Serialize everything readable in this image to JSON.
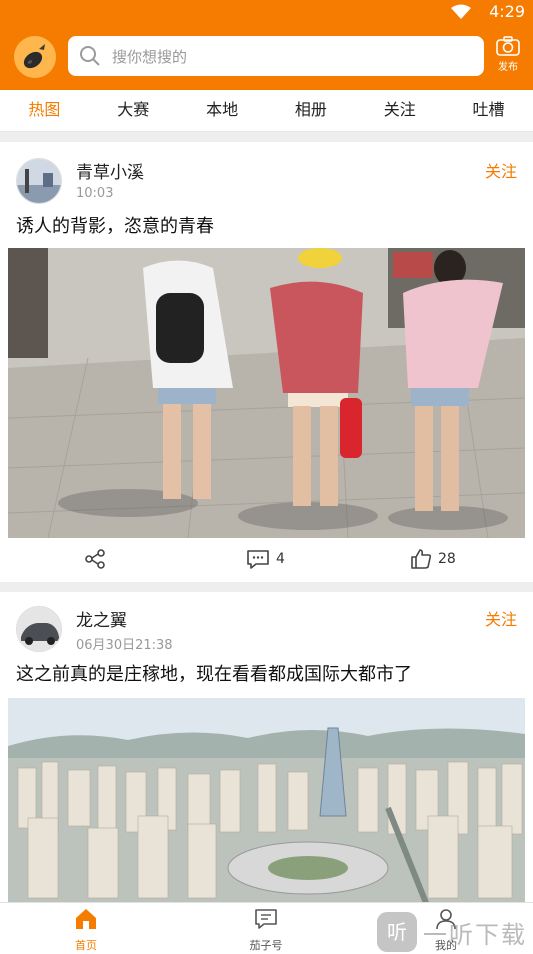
{
  "status": {
    "time": "4:29"
  },
  "header": {
    "search_placeholder": "搜你想搜的",
    "publish_label": "发布"
  },
  "tabs": [
    {
      "label": "热图",
      "active": true
    },
    {
      "label": "大赛"
    },
    {
      "label": "本地"
    },
    {
      "label": "相册"
    },
    {
      "label": "关注"
    },
    {
      "label": "吐槽"
    }
  ],
  "posts": [
    {
      "author": "青草小溪",
      "time": "10:03",
      "follow_label": "关注",
      "text": "诱人的背影，恣意的青春",
      "comments": "4",
      "likes": "28"
    },
    {
      "author": "龙之翼",
      "time": "06月30日21:38",
      "follow_label": "关注",
      "text": "这之前真的是庄稼地，现在看看都成国际大都市了"
    }
  ],
  "bottom_nav": [
    {
      "label": "首页",
      "active": true
    },
    {
      "label": "茄子号"
    },
    {
      "label": "我的"
    }
  ],
  "watermark": {
    "text": "一听下载"
  },
  "colors": {
    "accent": "#f57c00"
  }
}
